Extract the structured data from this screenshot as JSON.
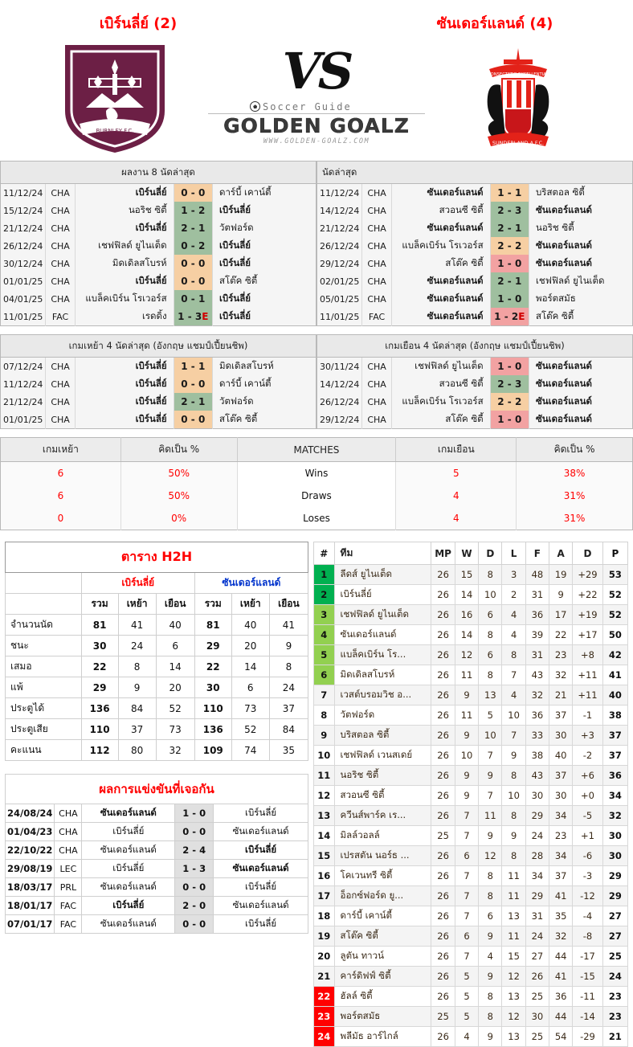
{
  "header": {
    "home_title": "เบิร์นลี่ย์ (2)",
    "away_title": "ซันเดอร์แลนด์ (4)",
    "vs": "VS",
    "brand_top": "Soccer Guide",
    "brand_main": "GOLDEN GOALZ",
    "brand_sub": "WWW.GOLDEN-GOALZ.COM",
    "home_crest_name": "burnley-fc-crest",
    "away_crest_name": "sunderland-afc-crest"
  },
  "last8": {
    "home": {
      "caption": "ผลงาน 8 นัดล่าสุด",
      "rows": [
        {
          "date": "11/12/24",
          "comp": "CHA",
          "home": "เบิร์นลี่ย์",
          "home_bold": true,
          "score": "0 - 0",
          "result": "d",
          "away": "ดาร์บี้ เคาน์ตี้",
          "away_bold": false
        },
        {
          "date": "15/12/24",
          "comp": "CHA",
          "home": "นอริช ซิตี้",
          "home_bold": false,
          "score": "1 - 2",
          "result": "w",
          "away": "เบิร์นลี่ย์",
          "away_bold": true
        },
        {
          "date": "21/12/24",
          "comp": "CHA",
          "home": "เบิร์นลี่ย์",
          "home_bold": true,
          "score": "2 - 1",
          "result": "w",
          "away": "วัตฟอร์ด",
          "away_bold": false
        },
        {
          "date": "26/12/24",
          "comp": "CHA",
          "home": "เชฟฟิลด์ ยูไนเต็ด",
          "home_bold": false,
          "score": "0 - 2",
          "result": "w",
          "away": "เบิร์นลี่ย์",
          "away_bold": true
        },
        {
          "date": "30/12/24",
          "comp": "CHA",
          "home": "มิดเดิลสโบรห์",
          "home_bold": false,
          "score": "0 - 0",
          "result": "d",
          "away": "เบิร์นลี่ย์",
          "away_bold": true
        },
        {
          "date": "01/01/25",
          "comp": "CHA",
          "home": "เบิร์นลี่ย์",
          "home_bold": true,
          "score": "0 - 0",
          "result": "d",
          "away": "สโต๊ค ซิตี้",
          "away_bold": false
        },
        {
          "date": "04/01/25",
          "comp": "CHA",
          "home": "แบล็คเบิร์น โรเวอร์ส",
          "home_bold": false,
          "score": "0 - 1",
          "result": "w",
          "away": "เบิร์นลี่ย์",
          "away_bold": true
        },
        {
          "date": "11/01/25",
          "comp": "FAC",
          "home": "เรดดิ้ง",
          "home_bold": false,
          "score": "1 - 3",
          "score_suffix": "E",
          "result": "w",
          "away": "เบิร์นลี่ย์",
          "away_bold": true
        }
      ]
    },
    "away": {
      "caption": "นัดล่าสุด",
      "rows": [
        {
          "date": "11/12/24",
          "comp": "CHA",
          "home": "ซันเดอร์แลนด์",
          "home_bold": true,
          "score": "1 - 1",
          "result": "d",
          "away": "บริสตอล ซิตี้",
          "away_bold": false
        },
        {
          "date": "14/12/24",
          "comp": "CHA",
          "home": "สวอนซี ซิตี้",
          "home_bold": false,
          "score": "2 - 3",
          "result": "w",
          "away": "ซันเดอร์แลนด์",
          "away_bold": true
        },
        {
          "date": "21/12/24",
          "comp": "CHA",
          "home": "ซันเดอร์แลนด์",
          "home_bold": true,
          "score": "2 - 1",
          "result": "w",
          "away": "นอริช ซิตี้",
          "away_bold": false
        },
        {
          "date": "26/12/24",
          "comp": "CHA",
          "home": "แบล็คเบิร์น โรเวอร์ส",
          "home_bold": false,
          "score": "2 - 2",
          "result": "d",
          "away": "ซันเดอร์แลนด์",
          "away_bold": true
        },
        {
          "date": "29/12/24",
          "comp": "CHA",
          "home": "สโต๊ค ซิตี้",
          "home_bold": false,
          "score": "1 - 0",
          "result": "l",
          "away": "ซันเดอร์แลนด์",
          "away_bold": true
        },
        {
          "date": "02/01/25",
          "comp": "CHA",
          "home": "ซันเดอร์แลนด์",
          "home_bold": true,
          "score": "2 - 1",
          "result": "w",
          "away": "เชฟฟิลด์ ยูไนเต็ด",
          "away_bold": false
        },
        {
          "date": "05/01/25",
          "comp": "CHA",
          "home": "ซันเดอร์แลนด์",
          "home_bold": true,
          "score": "1 - 0",
          "result": "w",
          "away": "พอร์ตสมัธ",
          "away_bold": false
        },
        {
          "date": "11/01/25",
          "comp": "FAC",
          "home": "ซันเดอร์แลนด์",
          "home_bold": true,
          "score": "1 - 2",
          "score_suffix": "E",
          "result": "l",
          "away": "สโต๊ค ซิตี้",
          "away_bold": false
        }
      ]
    }
  },
  "last4": {
    "home": {
      "caption": "เกมเหย้า 4 นัดล่าสุด (อังกฤษ แชมป์เปี้ยนชิพ)",
      "rows": [
        {
          "date": "07/12/24",
          "comp": "CHA",
          "home": "เบิร์นลี่ย์",
          "home_bold": true,
          "score": "1 - 1",
          "result": "d",
          "away": "มิดเดิลสโบรห์",
          "away_bold": false
        },
        {
          "date": "11/12/24",
          "comp": "CHA",
          "home": "เบิร์นลี่ย์",
          "home_bold": true,
          "score": "0 - 0",
          "result": "d",
          "away": "ดาร์บี้ เคาน์ตี้",
          "away_bold": false
        },
        {
          "date": "21/12/24",
          "comp": "CHA",
          "home": "เบิร์นลี่ย์",
          "home_bold": true,
          "score": "2 - 1",
          "result": "w",
          "away": "วัตฟอร์ด",
          "away_bold": false
        },
        {
          "date": "01/01/25",
          "comp": "CHA",
          "home": "เบิร์นลี่ย์",
          "home_bold": true,
          "score": "0 - 0",
          "result": "d",
          "away": "สโต๊ค ซิตี้",
          "away_bold": false
        }
      ]
    },
    "away": {
      "caption": "เกมเยือน 4 นัดล่าสุด (อังกฤษ แชมป์เปี้ยนชิพ)",
      "rows": [
        {
          "date": "30/11/24",
          "comp": "CHA",
          "home": "เชฟฟิลด์ ยูไนเต็ด",
          "home_bold": false,
          "score": "1 - 0",
          "result": "l",
          "away": "ซันเดอร์แลนด์",
          "away_bold": true
        },
        {
          "date": "14/12/24",
          "comp": "CHA",
          "home": "สวอนซี ซิตี้",
          "home_bold": false,
          "score": "2 - 3",
          "result": "w",
          "away": "ซันเดอร์แลนด์",
          "away_bold": true
        },
        {
          "date": "26/12/24",
          "comp": "CHA",
          "home": "แบล็คเบิร์น โรเวอร์ส",
          "home_bold": false,
          "score": "2 - 2",
          "result": "d",
          "away": "ซันเดอร์แลนด์",
          "away_bold": true
        },
        {
          "date": "29/12/24",
          "comp": "CHA",
          "home": "สโต๊ค ซิตี้",
          "home_bold": false,
          "score": "1 - 0",
          "result": "l",
          "away": "ซันเดอร์แลนด์",
          "away_bold": true
        }
      ]
    }
  },
  "matches_stats": {
    "headers": [
      "เกมเหย้า",
      "คิดเป็น %",
      "MATCHES",
      "เกมเยือน",
      "คิดเป็น %"
    ],
    "rows": [
      {
        "home": "6",
        "home_pct": "50%",
        "label": "Wins",
        "away": "5",
        "away_pct": "38%"
      },
      {
        "home": "6",
        "home_pct": "50%",
        "label": "Draws",
        "away": "4",
        "away_pct": "31%"
      },
      {
        "home": "0",
        "home_pct": "0%",
        "label": "Loses",
        "away": "4",
        "away_pct": "31%"
      }
    ]
  },
  "h2h": {
    "title": "ตาราง H2H",
    "team_a": "เบิร์นลี่ย์",
    "team_b": "ซันเดอร์แลนด์",
    "subheaders": [
      "รวม",
      "เหย้า",
      "เยือน",
      "รวม",
      "เหย้า",
      "เยือน"
    ],
    "rows": [
      {
        "label": "จำนวนนัด",
        "a_tot": "81",
        "a_h": "41",
        "a_a": "40",
        "b_tot": "81",
        "b_h": "40",
        "b_a": "41"
      },
      {
        "label": "ชนะ",
        "a_tot": "30",
        "a_h": "24",
        "a_a": "6",
        "b_tot": "29",
        "b_h": "20",
        "b_a": "9"
      },
      {
        "label": "เสมอ",
        "a_tot": "22",
        "a_h": "8",
        "a_a": "14",
        "b_tot": "22",
        "b_h": "14",
        "b_a": "8"
      },
      {
        "label": "แพ้",
        "a_tot": "29",
        "a_h": "9",
        "a_a": "20",
        "b_tot": "30",
        "b_h": "6",
        "b_a": "24"
      },
      {
        "label": "ประตูได้",
        "a_tot": "136",
        "a_h": "84",
        "a_a": "52",
        "b_tot": "110",
        "b_h": "73",
        "b_a": "37"
      },
      {
        "label": "ประตูเสีย",
        "a_tot": "110",
        "a_h": "37",
        "a_a": "73",
        "b_tot": "136",
        "b_h": "52",
        "b_a": "84"
      },
      {
        "label": "คะแนน",
        "a_tot": "112",
        "a_h": "80",
        "a_a": "32",
        "b_tot": "109",
        "b_h": "74",
        "b_a": "35"
      }
    ]
  },
  "h2h_results": {
    "title": "ผลการแข่งขันที่เจอกัน",
    "rows": [
      {
        "date": "24/08/24",
        "comp": "CHA",
        "home": "ซันเดอร์แลนด์",
        "home_bold": true,
        "score": "1 - 0",
        "away": "เบิร์นลี่ย์",
        "away_bold": false
      },
      {
        "date": "01/04/23",
        "comp": "CHA",
        "home": "เบิร์นลี่ย์",
        "home_bold": false,
        "score": "0 - 0",
        "away": "ซันเดอร์แลนด์",
        "away_bold": false
      },
      {
        "date": "22/10/22",
        "comp": "CHA",
        "home": "ซันเดอร์แลนด์",
        "home_bold": false,
        "score": "2 - 4",
        "away": "เบิร์นลี่ย์",
        "away_bold": true
      },
      {
        "date": "29/08/19",
        "comp": "LEC",
        "home": "เบิร์นลี่ย์",
        "home_bold": false,
        "score": "1 - 3",
        "away": "ซันเดอร์แลนด์",
        "away_bold": true
      },
      {
        "date": "18/03/17",
        "comp": "PRL",
        "home": "ซันเดอร์แลนด์",
        "home_bold": false,
        "score": "0 - 0",
        "away": "เบิร์นลี่ย์",
        "away_bold": false
      },
      {
        "date": "18/01/17",
        "comp": "FAC",
        "home": "เบิร์นลี่ย์",
        "home_bold": true,
        "score": "2 - 0",
        "away": "ซันเดอร์แลนด์",
        "away_bold": false
      },
      {
        "date": "07/01/17",
        "comp": "FAC",
        "home": "ซันเดอร์แลนด์",
        "home_bold": false,
        "score": "0 - 0",
        "away": "เบิร์นลี่ย์",
        "away_bold": false
      }
    ]
  },
  "standings": {
    "headers": [
      "#",
      "ทีม",
      "MP",
      "W",
      "D",
      "L",
      "F",
      "A",
      "D",
      "P"
    ],
    "rows": [
      {
        "rank": "1",
        "team": "ลีดส์ ยูไนเต็ด",
        "mp": "26",
        "w": "15",
        "d": "8",
        "l": "3",
        "f": "48",
        "a": "19",
        "gd": "+29",
        "p": "53",
        "zone": "promo"
      },
      {
        "rank": "2",
        "team": "เบิร์นลี่ย์",
        "mp": "26",
        "w": "14",
        "d": "10",
        "l": "2",
        "f": "31",
        "a": "9",
        "gd": "+22",
        "p": "52",
        "zone": "promo"
      },
      {
        "rank": "3",
        "team": "เชฟฟิลด์ ยูไนเต็ด",
        "mp": "26",
        "w": "16",
        "d": "6",
        "l": "4",
        "f": "36",
        "a": "17",
        "gd": "+19",
        "p": "52",
        "zone": "play"
      },
      {
        "rank": "4",
        "team": "ซันเดอร์แลนด์",
        "mp": "26",
        "w": "14",
        "d": "8",
        "l": "4",
        "f": "39",
        "a": "22",
        "gd": "+17",
        "p": "50",
        "zone": "play"
      },
      {
        "rank": "5",
        "team": "แบล็คเบิร์น โร...",
        "mp": "26",
        "w": "12",
        "d": "6",
        "l": "8",
        "f": "31",
        "a": "23",
        "gd": "+8",
        "p": "42",
        "zone": "play"
      },
      {
        "rank": "6",
        "team": "มิดเดิลสโบรห์",
        "mp": "26",
        "w": "11",
        "d": "8",
        "l": "7",
        "f": "43",
        "a": "32",
        "gd": "+11",
        "p": "41",
        "zone": "play"
      },
      {
        "rank": "7",
        "team": "เวสต์บรอมวิช อ...",
        "mp": "26",
        "w": "9",
        "d": "13",
        "l": "4",
        "f": "32",
        "a": "21",
        "gd": "+11",
        "p": "40",
        "zone": ""
      },
      {
        "rank": "8",
        "team": "วัตฟอร์ด",
        "mp": "26",
        "w": "11",
        "d": "5",
        "l": "10",
        "f": "36",
        "a": "37",
        "gd": "-1",
        "p": "38",
        "zone": ""
      },
      {
        "rank": "9",
        "team": "บริสตอล ซิตี้",
        "mp": "26",
        "w": "9",
        "d": "10",
        "l": "7",
        "f": "33",
        "a": "30",
        "gd": "+3",
        "p": "37",
        "zone": ""
      },
      {
        "rank": "10",
        "team": "เชฟฟิลด์ เวนสเดย์",
        "mp": "26",
        "w": "10",
        "d": "7",
        "l": "9",
        "f": "38",
        "a": "40",
        "gd": "-2",
        "p": "37",
        "zone": ""
      },
      {
        "rank": "11",
        "team": "นอริช ซิตี้",
        "mp": "26",
        "w": "9",
        "d": "9",
        "l": "8",
        "f": "43",
        "a": "37",
        "gd": "+6",
        "p": "36",
        "zone": ""
      },
      {
        "rank": "12",
        "team": "สวอนซี ซิตี้",
        "mp": "26",
        "w": "9",
        "d": "7",
        "l": "10",
        "f": "30",
        "a": "30",
        "gd": "+0",
        "p": "34",
        "zone": ""
      },
      {
        "rank": "13",
        "team": "ควีนส์พาร์ค เร...",
        "mp": "26",
        "w": "7",
        "d": "11",
        "l": "8",
        "f": "29",
        "a": "34",
        "gd": "-5",
        "p": "32",
        "zone": ""
      },
      {
        "rank": "14",
        "team": "มิลล์วอลล์",
        "mp": "25",
        "w": "7",
        "d": "9",
        "l": "9",
        "f": "24",
        "a": "23",
        "gd": "+1",
        "p": "30",
        "zone": ""
      },
      {
        "rank": "15",
        "team": "เปรสตัน นอร์ธ ...",
        "mp": "26",
        "w": "6",
        "d": "12",
        "l": "8",
        "f": "28",
        "a": "34",
        "gd": "-6",
        "p": "30",
        "zone": ""
      },
      {
        "rank": "16",
        "team": "โคเวนทรี ซิตี้",
        "mp": "26",
        "w": "7",
        "d": "8",
        "l": "11",
        "f": "34",
        "a": "37",
        "gd": "-3",
        "p": "29",
        "zone": ""
      },
      {
        "rank": "17",
        "team": "อ็อกซ์ฟอร์ด ยู...",
        "mp": "26",
        "w": "7",
        "d": "8",
        "l": "11",
        "f": "29",
        "a": "41",
        "gd": "-12",
        "p": "29",
        "zone": ""
      },
      {
        "rank": "18",
        "team": "ดาร์บี้ เคาน์ตี้",
        "mp": "26",
        "w": "7",
        "d": "6",
        "l": "13",
        "f": "31",
        "a": "35",
        "gd": "-4",
        "p": "27",
        "zone": ""
      },
      {
        "rank": "19",
        "team": "สโต๊ค ซิตี้",
        "mp": "26",
        "w": "6",
        "d": "9",
        "l": "11",
        "f": "24",
        "a": "32",
        "gd": "-8",
        "p": "27",
        "zone": ""
      },
      {
        "rank": "20",
        "team": "ลูตัน ทาวน์",
        "mp": "26",
        "w": "7",
        "d": "4",
        "l": "15",
        "f": "27",
        "a": "44",
        "gd": "-17",
        "p": "25",
        "zone": ""
      },
      {
        "rank": "21",
        "team": "คาร์ดิฟฟ์ ซิตี้",
        "mp": "26",
        "w": "5",
        "d": "9",
        "l": "12",
        "f": "26",
        "a": "41",
        "gd": "-15",
        "p": "24",
        "zone": ""
      },
      {
        "rank": "22",
        "team": "ฮัลล์ ซิตี้",
        "mp": "26",
        "w": "5",
        "d": "8",
        "l": "13",
        "f": "25",
        "a": "36",
        "gd": "-11",
        "p": "23",
        "zone": "releg"
      },
      {
        "rank": "23",
        "team": "พอร์ตสมัธ",
        "mp": "25",
        "w": "5",
        "d": "8",
        "l": "12",
        "f": "30",
        "a": "44",
        "gd": "-14",
        "p": "23",
        "zone": "releg"
      },
      {
        "rank": "24",
        "team": "พลีมัธ อาร์ไกล์",
        "mp": "26",
        "w": "4",
        "d": "9",
        "l": "13",
        "f": "25",
        "a": "54",
        "gd": "-29",
        "p": "21",
        "zone": "releg"
      }
    ]
  },
  "colors": {
    "win": "#9fbf9f",
    "draw": "#f6cfa3",
    "loss": "#f2a2a2",
    "accent_red": "#ff0000",
    "accent_blue": "#0033cc",
    "promotion": "#00b050",
    "playoff": "#92d050",
    "relegation": "#ff0000",
    "burnley_claret": "#6c1f45",
    "sunderland_red": "#e32219"
  }
}
